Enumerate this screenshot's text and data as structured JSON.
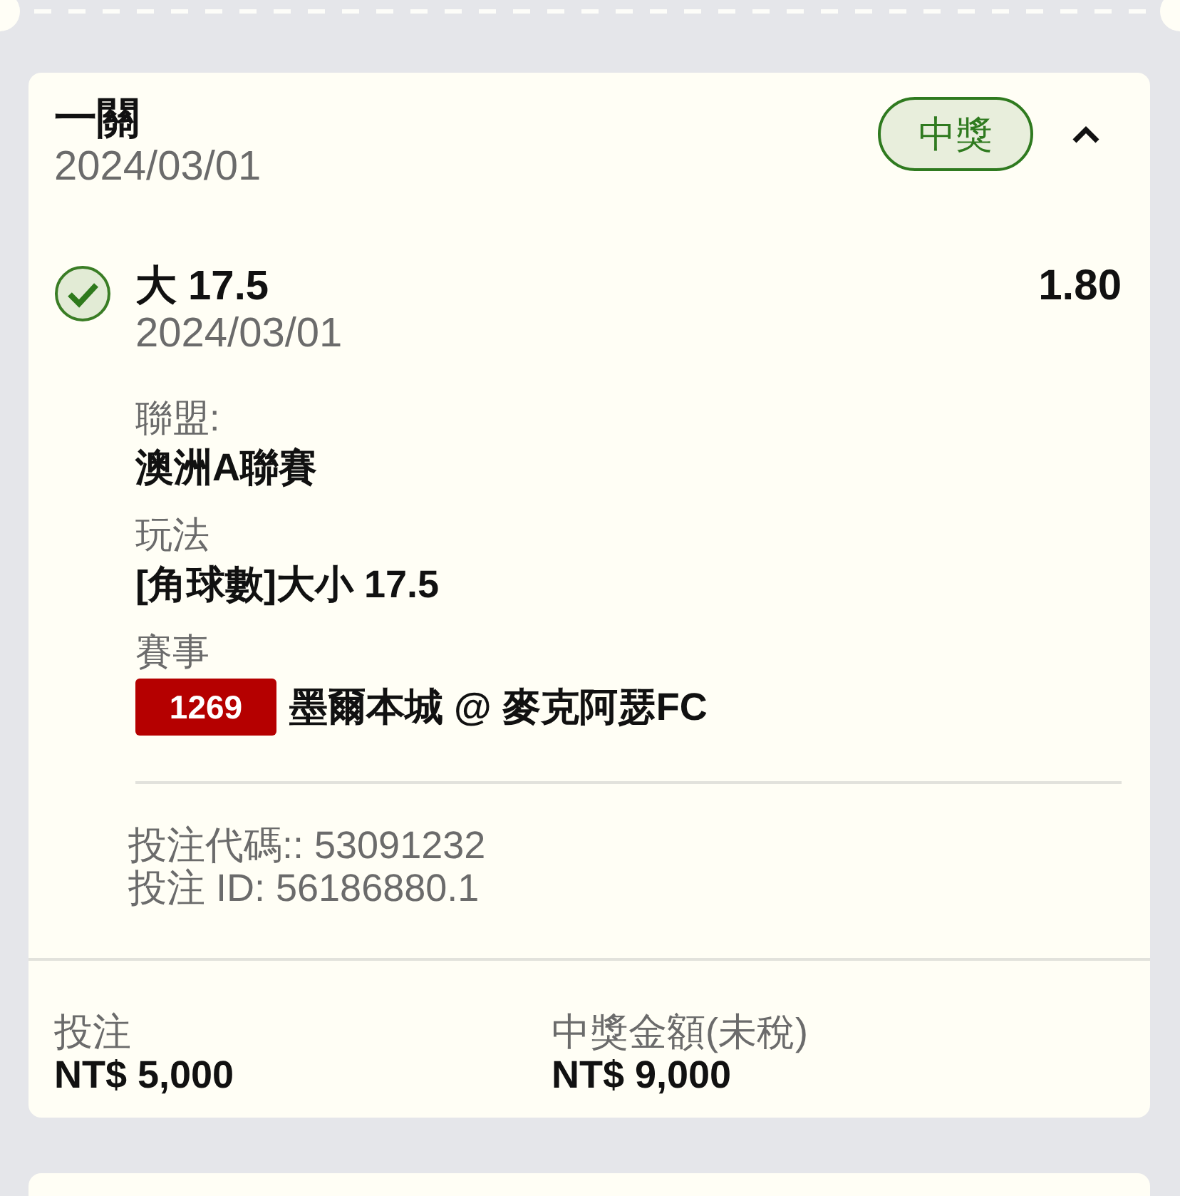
{
  "bet": {
    "type": "一關",
    "date": "2024/03/01",
    "status": {
      "label": "中獎",
      "kind": "won"
    },
    "expanded": true,
    "selections": [
      {
        "won": true,
        "pick": "大 17.5",
        "odds": "1.80",
        "date": "2024/03/01",
        "details": [
          {
            "kind": "text",
            "label": "聯盟:",
            "value": "澳洲A聯賽"
          },
          {
            "kind": "text",
            "label": "玩法",
            "value": "[角球數]大小 17.5"
          },
          {
            "kind": "match",
            "label": "賽事",
            "match_code": "1269",
            "value": "墨爾本城 @ 麥克阿瑟FC"
          }
        ]
      }
    ],
    "references": [
      "投注代碼:: 53091232",
      "投注 ID: 56186880.1"
    ],
    "summary": [
      {
        "label": "投注",
        "value": "NT$ 5,000"
      },
      {
        "label": "中獎金額(未稅)",
        "value": "NT$ 9,000"
      }
    ]
  }
}
